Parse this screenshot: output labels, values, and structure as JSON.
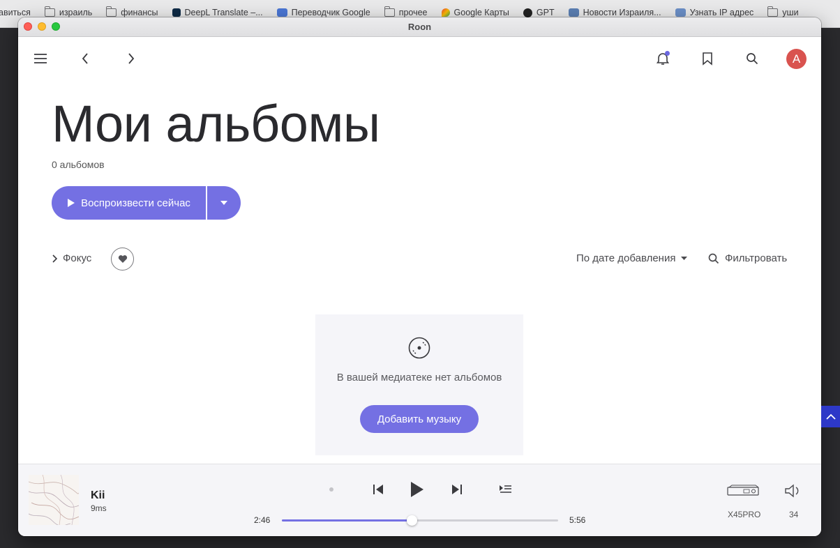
{
  "bookmarks": [
    {
      "label": "авиться",
      "icon": "none"
    },
    {
      "label": "израиль",
      "icon": "folder-icon"
    },
    {
      "label": "финансы",
      "icon": "folder-icon"
    },
    {
      "label": "DeepL Translate –...",
      "icon": "deepl-icon"
    },
    {
      "label": "Переводчик Google",
      "icon": "google-translate-icon"
    },
    {
      "label": "прочее",
      "icon": "folder-icon"
    },
    {
      "label": "Google Карты",
      "icon": "google-maps-icon"
    },
    {
      "label": "GPT",
      "icon": "openai-icon"
    },
    {
      "label": "Новости Израиля...",
      "icon": "news-icon"
    },
    {
      "label": "Узнать IP адрес",
      "icon": "ip-icon"
    },
    {
      "label": "уши",
      "icon": "folder-icon"
    }
  ],
  "window": {
    "title": "Roon"
  },
  "toolbar": {
    "avatar_letter": "A"
  },
  "page": {
    "title": "Мои альбомы",
    "count": "0 альбомов",
    "play_label": "Воспроизвести сейчас",
    "focus_label": "Фокус",
    "sort_label": "По дате добавления",
    "filter_label": "Фильтровать"
  },
  "empty": {
    "message": "В вашей медиатеке нет альбомов",
    "add_label": "Добавить музыку"
  },
  "player": {
    "track": "Kii",
    "artist": "9ms",
    "elapsed": "2:46",
    "total": "5:56",
    "progress": 0.47,
    "zone": "X45PRO",
    "volume": "34"
  },
  "colors": {
    "accent": "#7470e3",
    "avatar": "#d9534f"
  }
}
